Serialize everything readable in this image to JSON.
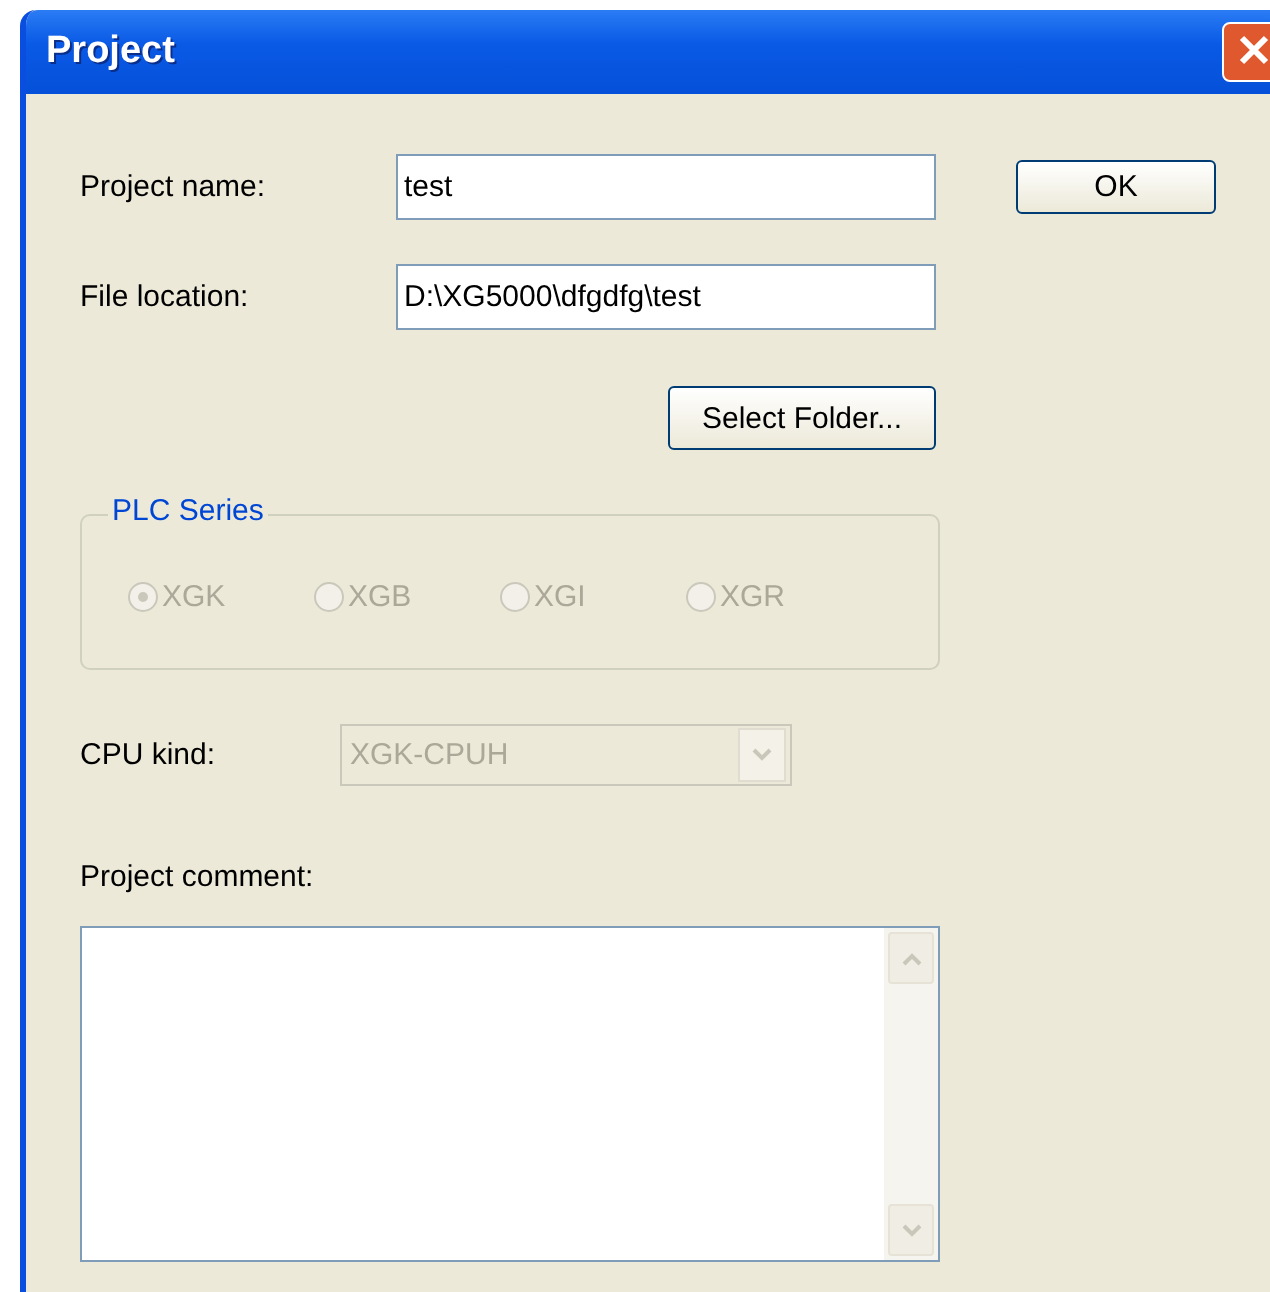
{
  "window": {
    "title": "Project"
  },
  "project_name": {
    "label": "Project name:",
    "value": "test"
  },
  "file_location": {
    "label": "File location:",
    "value": "D:\\XG5000\\dfgdfg\\test"
  },
  "buttons": [
    {
      "kind": "ok",
      "label": "OK"
    },
    {
      "kind": "select_folder",
      "label": "Select Folder..."
    }
  ],
  "plc_series": {
    "label": "PLC Series",
    "disabled": true,
    "options": [
      {
        "label": "XGK",
        "selected": true
      },
      {
        "label": "XGB",
        "selected": false
      },
      {
        "label": "XGI",
        "selected": false
      },
      {
        "label": "XGR",
        "selected": false
      }
    ]
  },
  "cpu_kind": {
    "label": "CPU kind:",
    "value": "XGK-CPUH",
    "disabled": true
  },
  "project_comment": {
    "label": "Project comment:"
  }
}
